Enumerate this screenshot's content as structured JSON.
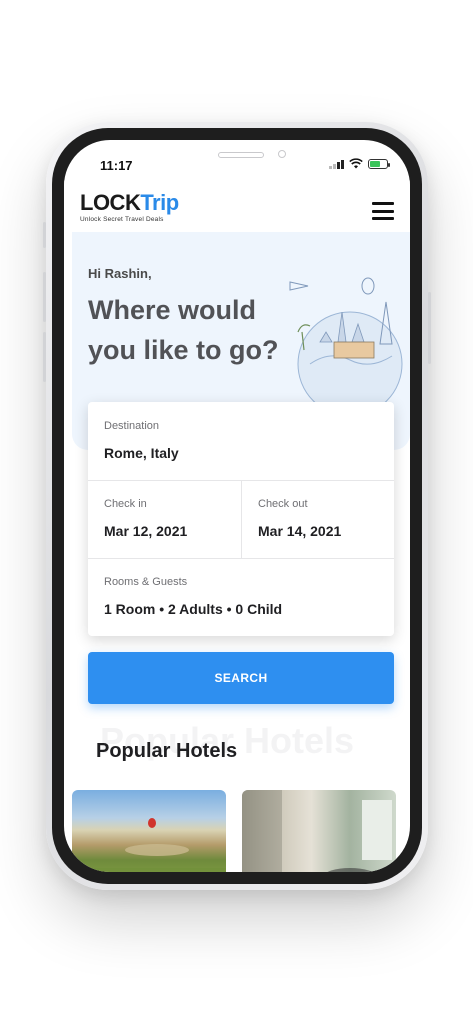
{
  "status_bar": {
    "time": "11:17"
  },
  "header": {
    "logo_lock": "LOCK",
    "logo_trip": "Trip",
    "tagline": "Unlock Secret Travel Deals"
  },
  "hero": {
    "greeting": "Hi Rashin,",
    "headline": "Where would you like to go?"
  },
  "search_form": {
    "destination": {
      "label": "Destination",
      "value": "Rome, Italy"
    },
    "check_in": {
      "label": "Check in",
      "value": "Mar 12, 2021"
    },
    "check_out": {
      "label": "Check out",
      "value": "Mar 14, 2021"
    },
    "rooms_guests": {
      "label": "Rooms & Guests",
      "value": "1 Room • 2 Adults • 0 Child"
    },
    "search_label": "SEARCH"
  },
  "popular": {
    "ghost_title": "Popular Hotels",
    "title": "Popular Hotels"
  },
  "colors": {
    "accent": "#2e8ff0",
    "logo_blue": "#2a8ae8",
    "hero_bg": "#eef5fd"
  },
  "icons": [
    "menu-icon",
    "signal-icon",
    "wifi-icon",
    "battery-icon",
    "travel-illustration"
  ]
}
